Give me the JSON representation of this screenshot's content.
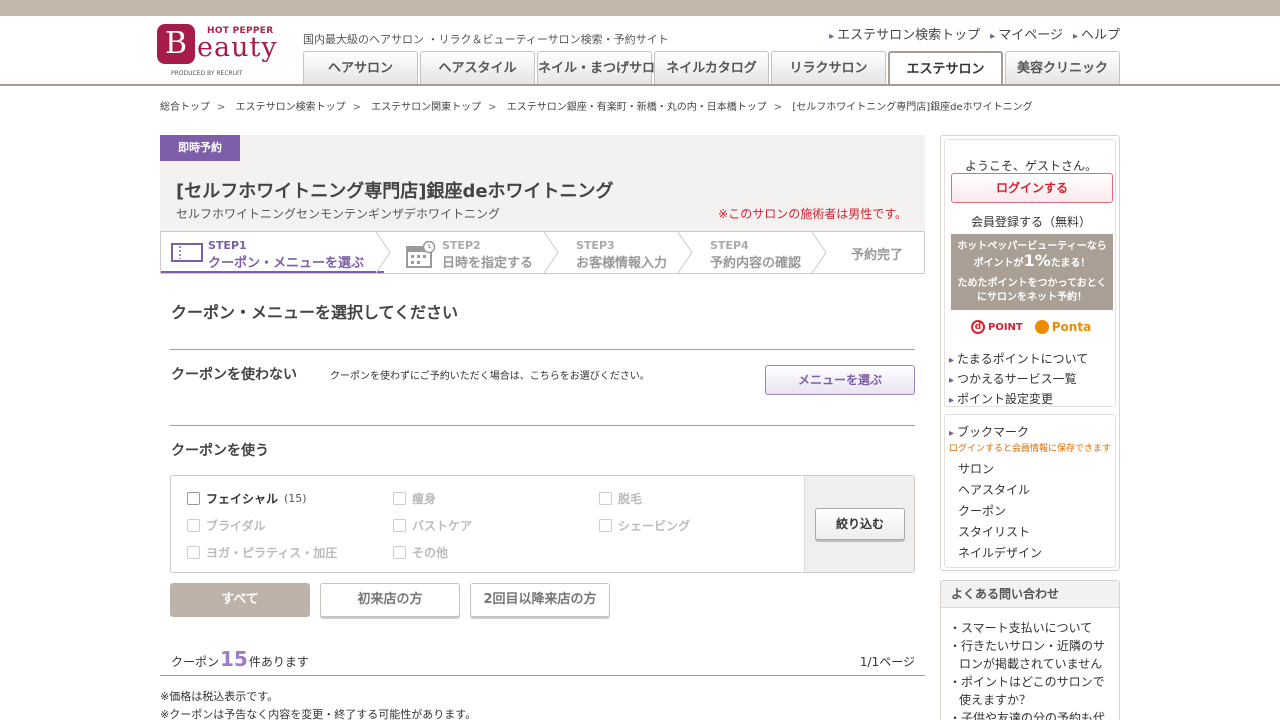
{
  "header": {
    "logo_top": "HOT PEPPER",
    "logo_b": "B",
    "logo_rest": "eauty",
    "logo_produced": "PRODUCED BY RECRUIT",
    "tagline": "国内最大級のヘアサロン ・リラク＆ビューティーサロン検索・予約サイト",
    "links": [
      "エステサロン検索トップ",
      "マイページ",
      "ヘルプ"
    ],
    "tabs": [
      "ヘアサロン",
      "ヘアスタイル",
      "ネイル・まつげサロン",
      "ネイルカタログ",
      "リラクサロン",
      "エステサロン",
      "美容クリニック"
    ],
    "active_tab": "エステサロン"
  },
  "breadcrumb": [
    "総合トップ",
    "エステサロン検索トップ",
    "エステサロン関東トップ",
    "エステサロン銀座・有楽町・新橋・丸の内・日本橋トップ",
    "[セルフホワイトニング専門店]銀座deホワイトニング"
  ],
  "salon": {
    "badge": "即時予約",
    "name": "[セルフホワイトニング専門店]銀座deホワイトニング",
    "kana": "セルフホワイトニングセンモンテンギンザデホワイトニング",
    "note": "※このサロンの施術者は男性です。"
  },
  "steps": [
    {
      "num": "STEP1",
      "label": "クーポン・メニューを選ぶ"
    },
    {
      "num": "STEP2",
      "label": "日時を指定する"
    },
    {
      "num": "STEP3",
      "label": "お客様情報入力"
    },
    {
      "num": "STEP4",
      "label": "予約内容の確認"
    },
    {
      "num": "",
      "label": "予約完了"
    }
  ],
  "section": {
    "title": "クーポン・メニューを選択してください",
    "no_coupon_title": "クーポンを使わない",
    "no_coupon_desc": "クーポンを使わずにご予約いただく場合は、こちらをお選びください。",
    "menu_button": "メニューを選ぶ",
    "use_coupon_title": "クーポンを使う"
  },
  "filter": {
    "categories": [
      {
        "label": "フェイシャル",
        "count": "(15)",
        "enabled": true
      },
      {
        "label": "痩身",
        "count": "",
        "enabled": false
      },
      {
        "label": "脱毛",
        "count": "",
        "enabled": false
      },
      {
        "label": "ブライダル",
        "count": "",
        "enabled": false
      },
      {
        "label": "バストケア",
        "count": "",
        "enabled": false
      },
      {
        "label": "シェービング",
        "count": "",
        "enabled": false
      },
      {
        "label": "ヨガ・ピラティス・加圧",
        "count": "",
        "enabled": false
      },
      {
        "label": "その他",
        "count": "",
        "enabled": false
      }
    ],
    "button": "絞り込む"
  },
  "segments": [
    "すべて",
    "初来店の方",
    "2回目以降来店の方"
  ],
  "selected_segment": "すべて",
  "results": {
    "prefix": "クーポン",
    "count": "15",
    "suffix": "件あります",
    "pages": "1/1ページ"
  },
  "notes": [
    "※価格は税込表示です。",
    "※クーポンは予告なく内容を変更・終了する可能性があります。"
  ],
  "sidebar": {
    "welcome": "ようこそ、ゲストさん。",
    "login": "ログインする",
    "register": "会員登録する（無料）",
    "promo_l1": "ホットペッパービューティーなら",
    "promo_l2a": "ポイントが",
    "promo_pct": "1%",
    "promo_l2b": "たまる！",
    "promo_l3": "ためたポイントをつかっておとく",
    "promo_l4": "にサロンをネット予約！",
    "dpoint": "POINT",
    "dpoint_mark": "d",
    "ponta": "Ponta",
    "point_links": [
      "たまるポイントについて",
      "つかえるサービス一覧",
      "ポイント設定変更"
    ],
    "bookmark_title": "ブックマーク",
    "bookmark_note": "ログインすると会員情報に保存できます",
    "bookmark_items": [
      "サロン",
      "ヘアスタイル",
      "クーポン",
      "スタイリスト",
      "ネイルデザイン"
    ],
    "faq_title": "よくある問い合わせ",
    "faq_items": [
      "スマート支払いについて",
      "行きたいサロン・近隣のサロンが掲載されていません",
      "ポイントはどこのサロンで使えますか？",
      "子供や友達の分の予約も代理"
    ]
  },
  "colors": {
    "accent": "#7c5fa8",
    "brand": "#a51d48",
    "alert": "#d8202f",
    "beige": "#a99f94"
  }
}
